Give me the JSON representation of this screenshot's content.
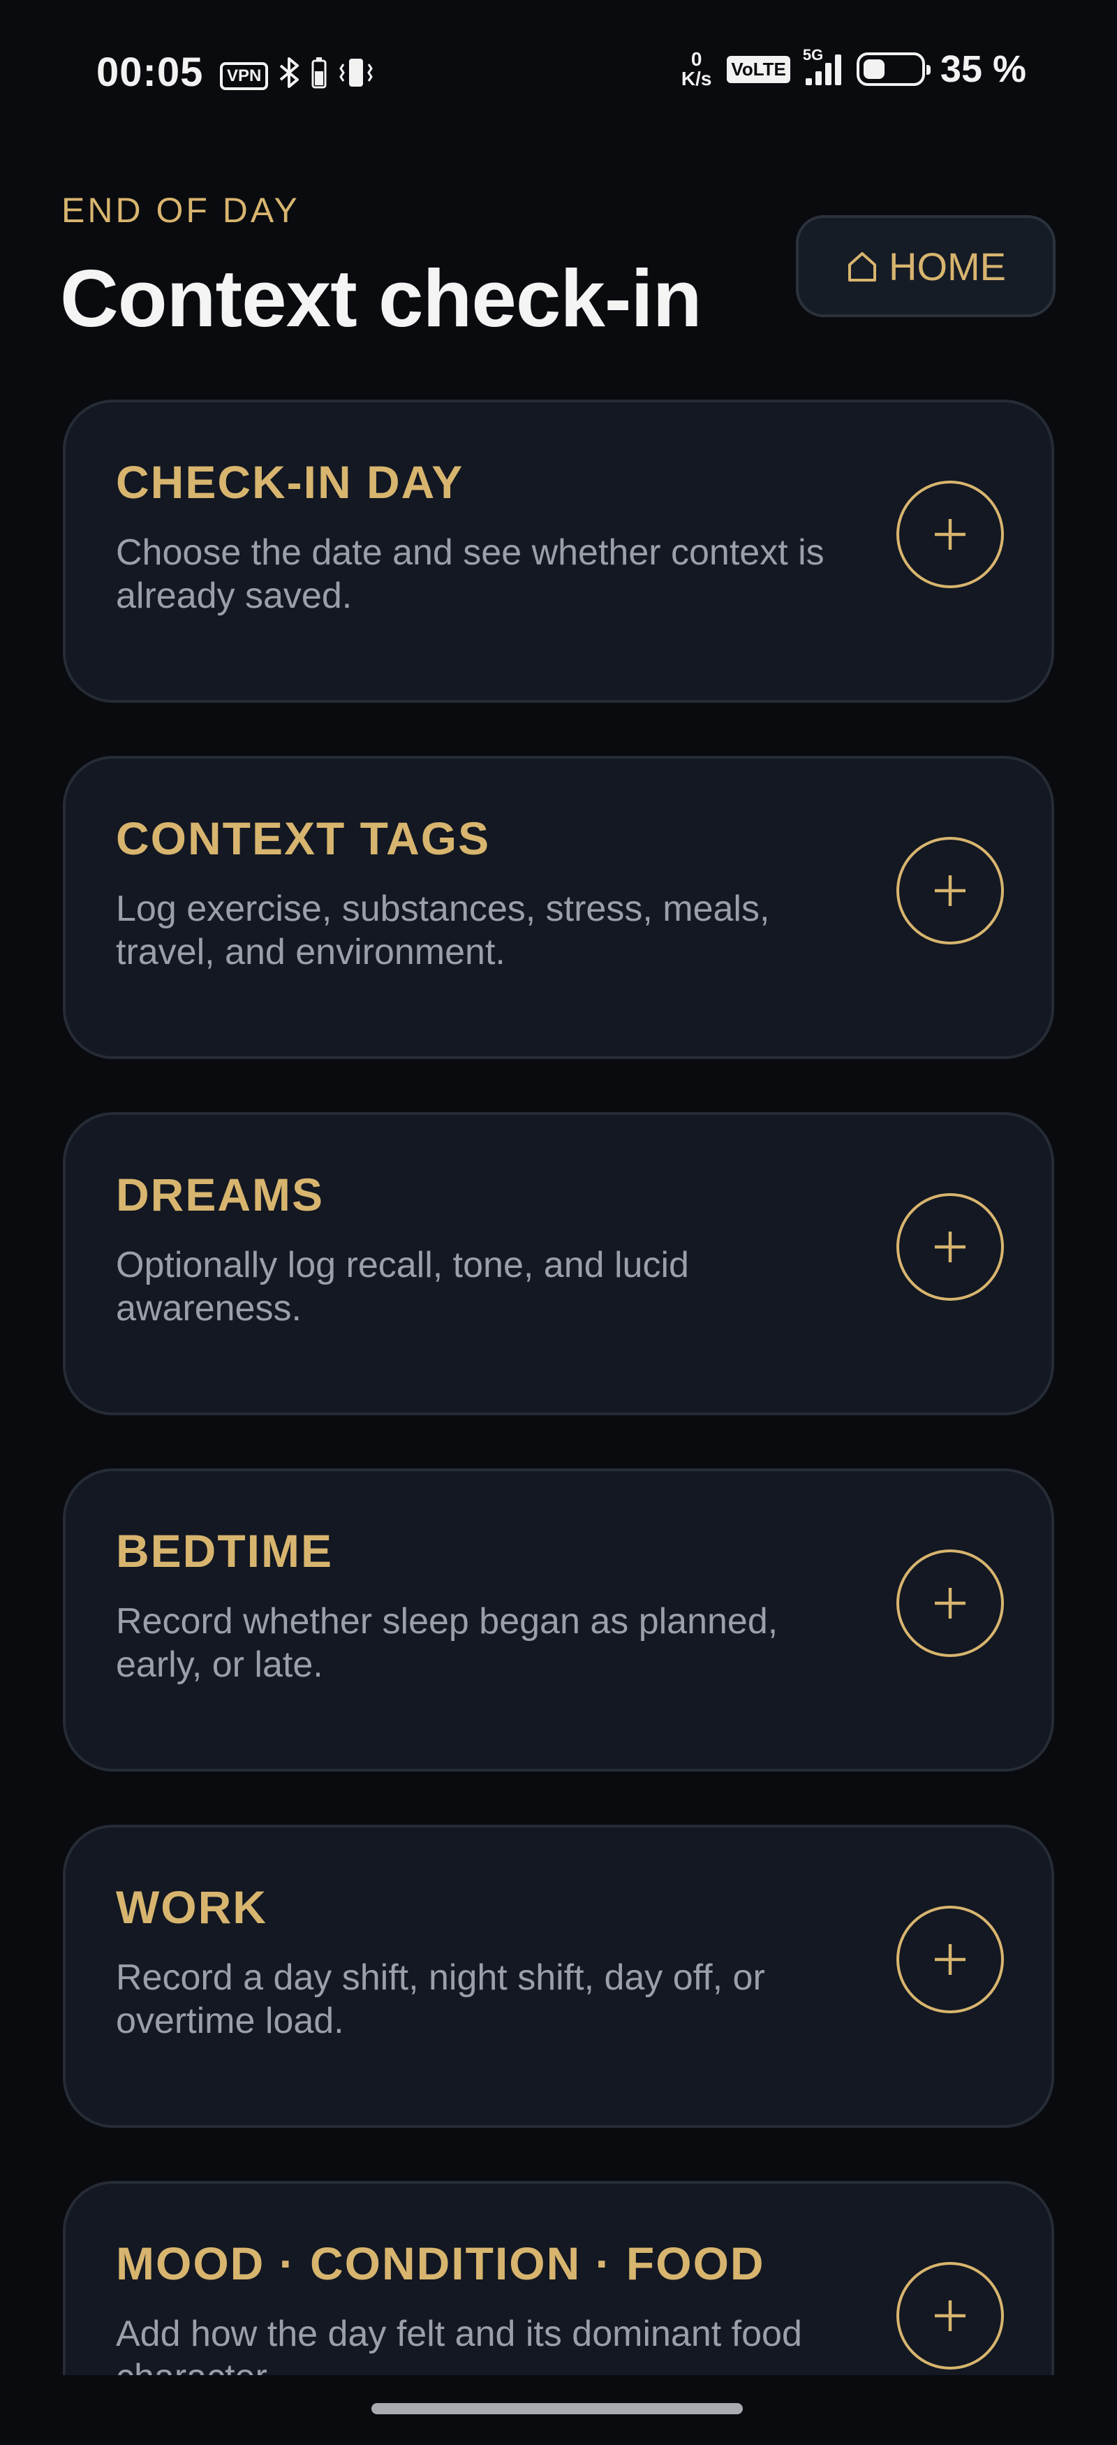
{
  "status_bar": {
    "time": "00:05",
    "vpn": "VPN",
    "net_speed_value": "0",
    "net_speed_unit": "K/s",
    "volte": "VoLTE",
    "network": "5G",
    "battery_percent": "35 %"
  },
  "header": {
    "eyebrow": "END OF DAY",
    "title": "Context check-in",
    "home_label": "HOME"
  },
  "cards": [
    {
      "title": "CHECK-IN DAY",
      "description": "Choose the date and see whether context is already saved."
    },
    {
      "title": "CONTEXT TAGS",
      "description": "Log exercise, substances, stress, meals, travel, and environment."
    },
    {
      "title": "DREAMS",
      "description": "Optionally log recall, tone, and lucid awareness."
    },
    {
      "title": "BEDTIME",
      "description": "Record whether sleep began as planned, early, or late."
    },
    {
      "title": "WORK",
      "description": "Record a day shift, night shift, day off, or overtime load."
    },
    {
      "title": "MOOD · CONDITION · FOOD",
      "description": "Add how the day felt and its dominant food character."
    }
  ],
  "colors": {
    "background": "#090b0f",
    "card": "#131822",
    "accent_gold": "#d8b56f",
    "text_primary": "#f4f4f4",
    "text_secondary": "#9ba0a8"
  },
  "icons": {
    "home": "home-icon",
    "add": "plus-icon"
  }
}
